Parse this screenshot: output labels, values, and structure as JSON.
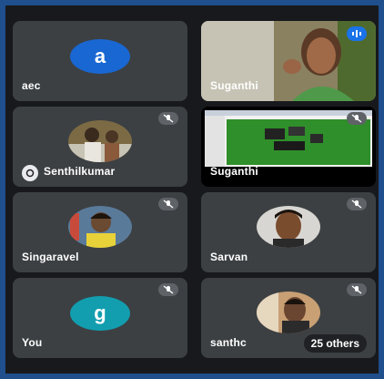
{
  "participants": [
    {
      "name": "aec",
      "avatar_letter": "a",
      "avatar_color": "#1967d2"
    },
    {
      "name": "Suganthi",
      "status": "speaking"
    },
    {
      "name": "Senthilkumar",
      "status": "muted"
    },
    {
      "name": "Suganthi",
      "status": "muted",
      "presenting": true
    },
    {
      "name": "Singaravel",
      "status": "muted"
    },
    {
      "name": "Sarvan",
      "status": "muted"
    },
    {
      "name": "You",
      "avatar_letter": "g",
      "avatar_color": "#129eaf",
      "status": "muted"
    },
    {
      "name": "santhc",
      "status": "muted"
    }
  ],
  "overflow": {
    "label": "25 others"
  },
  "colors": {
    "tile_bg": "#3c4043",
    "window_bg": "#17191c",
    "border": "#1f4f8c"
  },
  "icons": [
    "mic-off-icon",
    "audio-level-icon",
    "pin-icon"
  ]
}
